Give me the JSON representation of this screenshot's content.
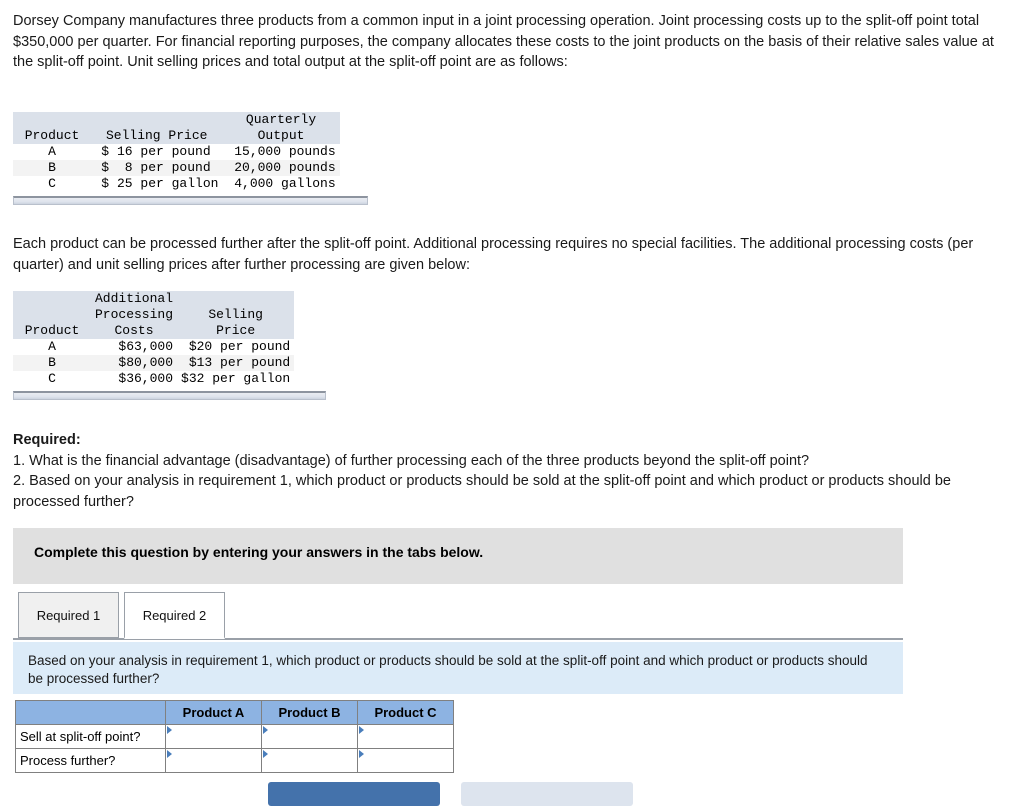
{
  "intro": "Dorsey Company manufactures three products from a common input in a joint processing operation. Joint processing costs up to the split-off point total $350,000 per quarter. For financial reporting purposes, the company allocates these costs to the joint products on the basis of their relative sales value at the split-off point. Unit selling prices and total output at the split-off point are as follows:",
  "table1": {
    "headers": {
      "product": "Product",
      "selling_price": "Selling Price",
      "output_line1": "Quarterly",
      "output_line2": "Output"
    },
    "rows": [
      {
        "product": "A",
        "currency": "$",
        "price": "16 per pound",
        "output": "15,000 pounds"
      },
      {
        "product": "B",
        "currency": "$",
        "price": " 8 per pound",
        "output": "20,000 pounds"
      },
      {
        "product": "C",
        "currency": "$",
        "price": "25 per gallon",
        "output": " 4,000 gallons"
      }
    ]
  },
  "para2": "Each product can be processed further after the split-off point. Additional processing requires no special facilities. The additional processing costs (per quarter) and unit selling prices after further processing are given below:",
  "table2": {
    "headers": {
      "product": "Product",
      "costs_line1": "Additional",
      "costs_line2": "Processing",
      "costs_line3": "Costs",
      "price_line1": "Selling",
      "price_line2": "Price"
    },
    "rows": [
      {
        "product": "A",
        "cost": "$63,000",
        "price": "$20 per pound"
      },
      {
        "product": "B",
        "cost": "$80,000",
        "price": "$13 per pound"
      },
      {
        "product": "C",
        "cost": "$36,000",
        "price": "$32 per gallon"
      }
    ]
  },
  "required": {
    "title": "Required:",
    "item1": "1. What is the financial advantage (disadvantage) of further processing each of the three products beyond the split-off point?",
    "item2": "2. Based on your analysis in requirement 1, which product or products should be sold at the split-off point and which product or products should be processed further?"
  },
  "banner": {
    "text": "Complete this question by entering your answers in the tabs below."
  },
  "tabs": [
    {
      "label": "Required 1",
      "active": false
    },
    {
      "label": "Required 2",
      "active": true
    }
  ],
  "info_box": {
    "text": "Based on your analysis in requirement 1, which product or products should be sold at the split-off point and which product or products should be processed further?"
  },
  "answer_table": {
    "corner": "",
    "columns": [
      "Product A",
      "Product B",
      "Product C"
    ],
    "rows": [
      {
        "label": "Sell at split-off point?",
        "values": [
          "",
          "",
          ""
        ]
      },
      {
        "label": "Process further?",
        "values": [
          "",
          "",
          ""
        ]
      }
    ]
  },
  "buttons": {
    "primary": "",
    "secondary": ""
  },
  "colors": {
    "header_blue": "#8db3e2",
    "info_blue": "#dcebf8",
    "banner_gray": "#e0e0e0",
    "table_header_gray": "#dbe1ea",
    "primary_button": "#4472ab",
    "secondary_button": "#dde4ee",
    "dropdown_marker": "#4a7ebb"
  }
}
